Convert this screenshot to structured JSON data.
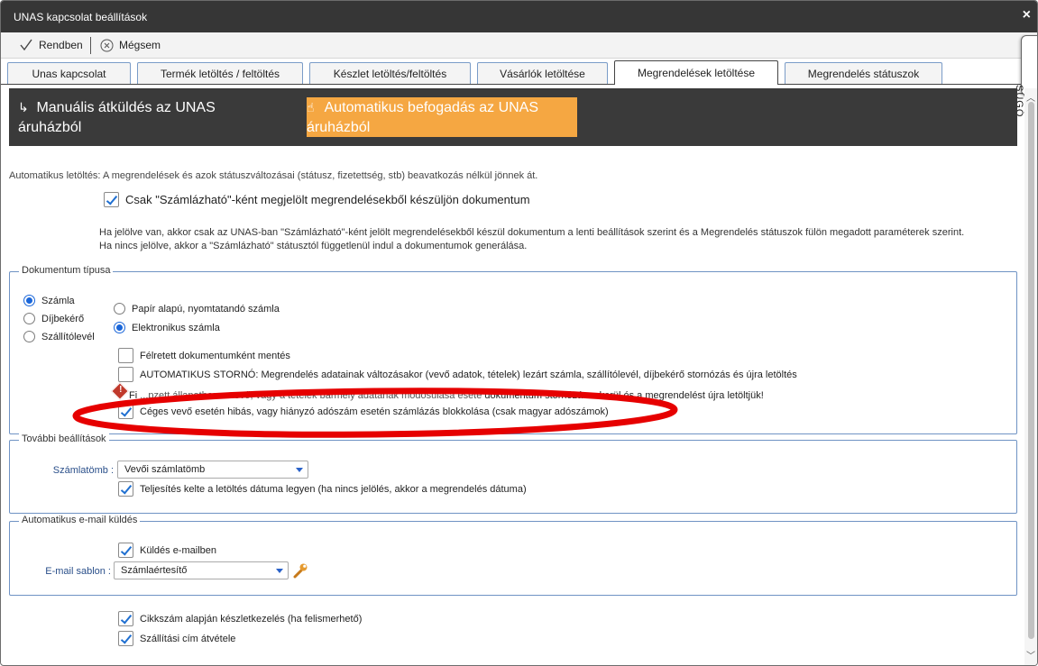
{
  "window": {
    "title": "UNAS kapcsolat beállítások",
    "close_glyph": "×"
  },
  "toolbar": {
    "ok_label": "Rendben",
    "cancel_label": "Mégsem"
  },
  "tabs": [
    {
      "label": "Unas kapcsolat"
    },
    {
      "label": "Termék letöltés / feltöltés"
    },
    {
      "label": "Készlet letöltés/feltöltés"
    },
    {
      "label": "Vásárlók letöltése"
    },
    {
      "label": "Megrendelések letöltése",
      "active": true
    },
    {
      "label": "Megrendelés státuszok"
    }
  ],
  "help_tab": "SÚGÓ",
  "modes": {
    "manual_line1": "Manuális átküldés az UNAS",
    "manual_line2": "áruházból",
    "auto_line1": "Automatikus befogadás az UNAS",
    "auto_line2": "áruházból",
    "auto_color": "#f5a742"
  },
  "auto_info": "Automatikus letöltés: A megrendelések és azok státuszváltozásai (státusz, fizetettség, stb) beavatkozás nélkül jönnek át.",
  "invoiceable_only": {
    "label": "Csak \"Számlázható\"-ként megjelölt megrendelésekből készüljön dokumentum",
    "checked": true
  },
  "help_text": {
    "line1": "Ha jelölve van, akkor csak az UNAS-ban \"Számlázható\"-ként jelölt megrendelésekből készül dokumentum a lenti beállítások szerint és a Megrendelés státuszok fülön megadott paraméterek szerint.",
    "line2": "Ha nincs jelölve, akkor a \"Számlázható\" státusztól függetlenül indul a dokumentumok generálása."
  },
  "doc_type": {
    "legend": "Dokumentum típusa",
    "types": [
      "Számla",
      "Díjbekérő",
      "Szállítólevél"
    ],
    "selected_type": "Számla",
    "formats": [
      "Papír alapú, nyomtatandó számla",
      "Elektronikus számla"
    ],
    "selected_format": "Elektronikus számla",
    "save_as_pending": {
      "label": "Félretett dokumentumként mentés",
      "checked": false
    },
    "auto_storno": {
      "label": "AUTOMATIKUS STORNÓ: Megrendelés adatainak változásakor (vevő adatok, tételek) lezárt számla, szállítólevél, díjbekérő stornózás és újra letöltés",
      "checked": false
    },
    "warning_text_left": "Fi",
    "warning_text_mid": "...pzett állapotban a vevő, vagy a tételek bármely adatának módosulása eseté",
    "warning_text_right": "dokumentum stornózásra kerül és a megrendelést újra letöltjük!",
    "tax_block": {
      "label": "Céges vevő esetén hibás, vagy hiányzó adószám esetén számlázás blokkolása (csak magyar adószámok)",
      "checked": true
    }
  },
  "more_settings": {
    "legend": "További beállítások",
    "invoice_block_label": "Számlatömb :",
    "invoice_block_value": "Vevői számlatömb",
    "fulfillment": {
      "label": "Teljesítés kelte a letöltés dátuma legyen (ha nincs jelölés, akkor a megrendelés dátuma)",
      "checked": true
    }
  },
  "email": {
    "legend": "Automatikus e-mail küldés",
    "send": {
      "label": "Küldés e-mailben",
      "checked": true
    },
    "template_label": "E-mail sablon :",
    "template_value": "Számlaértesítő"
  },
  "bottom": {
    "sku_stock": {
      "label": "Cikkszám alapján készletkezelés (ha felismerhető)",
      "checked": true
    },
    "shipping": {
      "label": "Szállítási cím átvétele",
      "checked": true
    }
  },
  "annotation_color": "#e60000"
}
